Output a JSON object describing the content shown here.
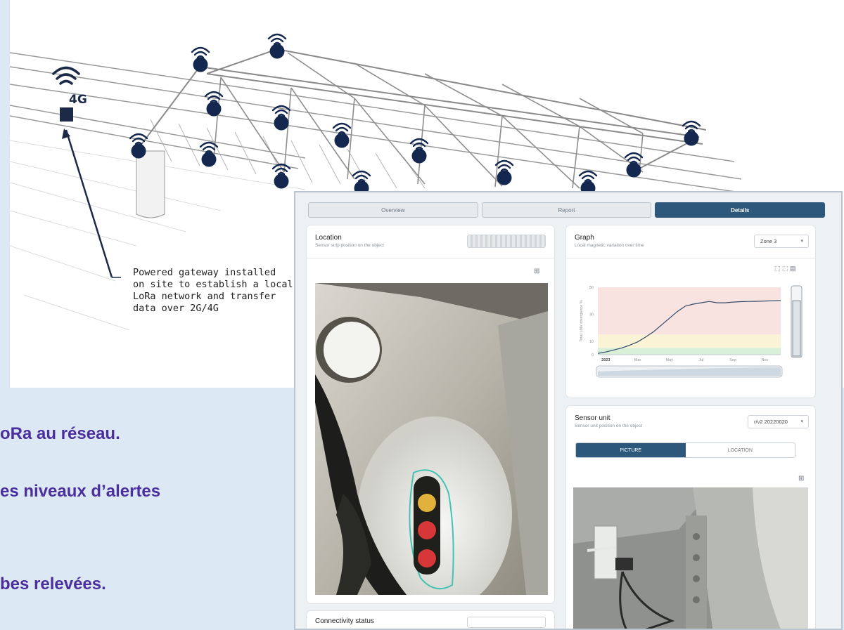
{
  "illustration": {
    "gateway_label": "4G",
    "callout_lines": [
      "Powered gateway installed",
      "on site to establish a local",
      "LoRa network and transfer",
      "data over 2G/4G"
    ],
    "icons": [
      "wifi-icon",
      "sensor-dot-icon",
      "gateway-box-icon"
    ]
  },
  "slide_lines": [
    "oRa au réseau.",
    "es niveaux d’alertes",
    "bes relevées."
  ],
  "dashboard": {
    "tabs": [
      {
        "label": "Overview",
        "active": false
      },
      {
        "label": "Report",
        "active": false
      },
      {
        "label": "Details",
        "active": true
      }
    ],
    "location": {
      "title": "Location",
      "subtitle": "Sensor strip position on the object"
    },
    "graph": {
      "title": "Graph",
      "subtitle": "Local magnetic variation over time",
      "zone_select": "Zone 3"
    },
    "sensor_unit": {
      "title": "Sensor unit",
      "subtitle": "Sensor unit position on the object",
      "version_select": "r/v2 20220020",
      "seg_picture": "PICTURE",
      "seg_location": "LOCATION"
    },
    "connectivity": {
      "title": "Connectivity status"
    }
  },
  "chart_data": {
    "type": "line",
    "title": "",
    "xlabel": "",
    "ylabel": "Total LMV divergence %",
    "x_tick_labels": [
      "2023",
      "Mar",
      "May",
      "Jul",
      "Sep",
      "Nov"
    ],
    "y_tick_labels": [
      "0",
      "10",
      "30",
      "50"
    ],
    "ylim": [
      0,
      50
    ],
    "x": [
      0,
      0.5,
      1,
      1.5,
      2,
      2.5,
      3,
      3.5,
      4,
      4.5,
      5,
      5.5,
      6,
      6.5,
      7,
      7.5,
      8,
      8.5,
      9,
      9.5,
      10,
      10.5,
      11,
      11.5
    ],
    "series": [
      {
        "values": [
          1,
          2,
          3.5,
          5,
          7,
          9.5,
          13,
          17,
          22,
          27,
          32,
          36,
          37.5,
          38.5,
          39.5,
          38.5,
          38.5,
          39,
          39.3,
          39.5,
          39.6,
          39.8,
          40,
          40.2
        ]
      }
    ],
    "bands": [
      {
        "from": 0,
        "to": 5,
        "color": "#d8efd8"
      },
      {
        "from": 5,
        "to": 15,
        "color": "#fbf3d6"
      },
      {
        "from": 15,
        "to": 50,
        "color": "#f8e3e0"
      }
    ],
    "line_color": "#2f4a6b"
  }
}
